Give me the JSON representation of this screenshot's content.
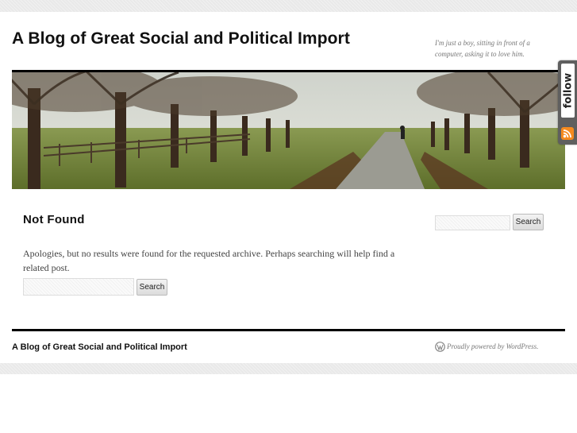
{
  "site": {
    "title": "A Blog of Great Social and Political Import",
    "tagline": "I'm just a boy, sitting in front of a computer, asking it to love him."
  },
  "follow_tab": {
    "label": "follow",
    "icons": [
      "rss-icon"
    ]
  },
  "main": {
    "heading": "Not Found",
    "message": "Apologies, but no results were found for the requested archive. Perhaps searching will help find a related post.",
    "search": {
      "value": "",
      "button_label": "Search"
    }
  },
  "sidebar": {
    "search": {
      "value": "",
      "button_label": "Search"
    }
  },
  "footer": {
    "site_title": "A Blog of Great Social and Political Import",
    "credit": "Proudly powered by WordPress."
  },
  "colors": {
    "background_band": "#e9e9e9",
    "page": "#ffffff",
    "title_text": "#111111",
    "body_text": "#444444",
    "rule": "#000000",
    "follow_tab": "#5f5f5f",
    "rss": "#f58a1f"
  }
}
